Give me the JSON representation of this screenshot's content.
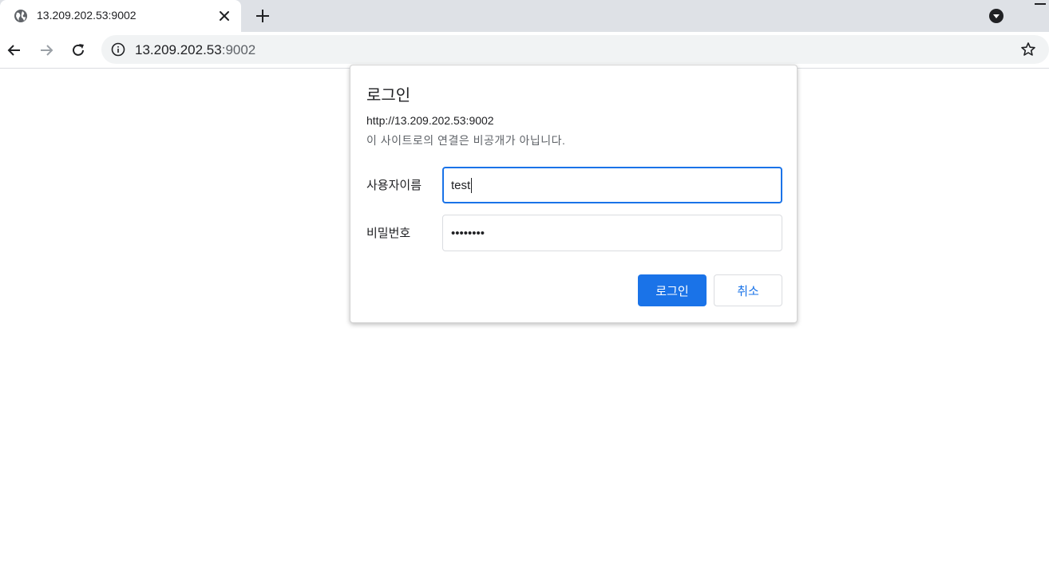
{
  "tab": {
    "title": "13.209.202.53:9002",
    "favicon": "globe-icon"
  },
  "toolbar": {
    "back_icon": "arrow-left-icon",
    "forward_icon": "arrow-right-icon",
    "reload_icon": "reload-icon",
    "bookmark_icon": "star-icon"
  },
  "omnibox": {
    "site_info_icon": "info-icon",
    "url_host": "13.209.202.53",
    "url_port": ":9002"
  },
  "dialog": {
    "title": "로그인",
    "origin": "http://13.209.202.53:9002",
    "warning": "이 사이트로의 연결은 비공개가 아닙니다.",
    "username_label": "사용자이름",
    "username_value": "test",
    "password_label": "비밀번호",
    "password_value": "••••••••",
    "login_button": "로그인",
    "cancel_button": "취소"
  },
  "colors": {
    "accent": "#1a73e8",
    "tabstrip": "#dee1e6",
    "omnibox": "#f1f3f4"
  }
}
